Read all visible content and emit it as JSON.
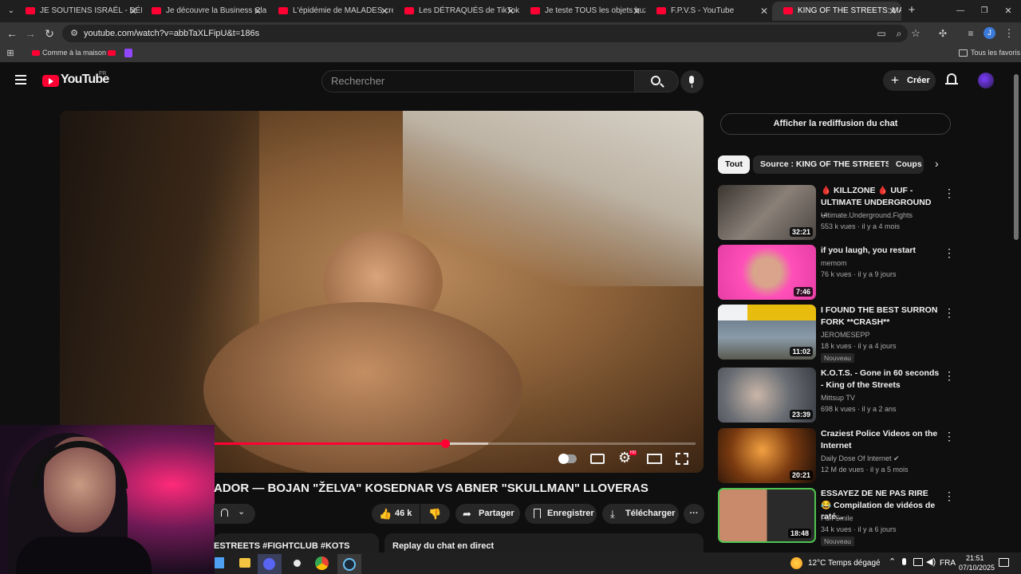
{
  "browser": {
    "tabs": [
      {
        "title": "JE SOUTIENS ISRAËL - DÉBAT DU"
      },
      {
        "title": "Je découvre la Business Class en"
      },
      {
        "title": "L'épidémie de MALADES créée"
      },
      {
        "title": "Les DÉTRAQUÉS de TikTok - Yo"
      },
      {
        "title": "Je teste TOUS les objets buzz d"
      },
      {
        "title": "F.P.V.S - YouTube"
      },
      {
        "title": "KING OF THE STREETS: MATADO"
      }
    ],
    "new_tab": "+",
    "url": "youtube.com/watch?v=abbTaXLFipU&t=186s",
    "bookmark_home": "Comme à la maison",
    "all_bookmarks": "Tous les favoris",
    "profile_letter": "J"
  },
  "youtube": {
    "logo": "YouTube",
    "region": "FR",
    "search_placeholder": "Rechercher",
    "create_label": "Créer",
    "video_title": "ADOR — BOJAN \"ŽELVA\" KOSEDNAR VS ABNER \"SKULLMAN\" LLOVERAS",
    "progress": 0.48,
    "buffered": 0.57,
    "hd_badge": "HD",
    "likes": "46 k",
    "share": "Partager",
    "save": "Enregistrer",
    "download": "Télécharger",
    "more": "···",
    "hashtags": "ESTREETS #FIGHTCLUB #KOTS",
    "replay_chat": "Replay du chat en direct",
    "show_chat": "Afficher la rediffusion du chat",
    "chips": [
      "Tout",
      "Source : KING OF THE STREETS",
      "Coups"
    ],
    "recommendations": [
      {
        "title": "🩸 KILLZONE 🩸 UUF - ULTIMATE UNDERGROUND ...",
        "channel": "Ultimate.Underground.Fights",
        "meta": "553 k vues · il y a 4 mois",
        "duration": "32:21",
        "badge": ""
      },
      {
        "title": "if you laugh, you restart",
        "channel": "memom",
        "meta": "76 k vues · il y a 9 jours",
        "duration": "7:46",
        "badge": ""
      },
      {
        "title": "I FOUND THE BEST SURRON FORK **CRASH**",
        "channel": "JEROMESEPP",
        "meta": "18 k vues · il y a 4 jours",
        "duration": "11:02",
        "badge": "Nouveau"
      },
      {
        "title": "K.O.T.S. - Gone in 60 seconds - King of the Streets",
        "channel": "Mittsup TV",
        "meta": "698 k vues · il y a 2 ans",
        "duration": "23:39",
        "badge": ""
      },
      {
        "title": "Craziest Police Videos on the Internet",
        "channel": "Daily Dose Of Internet ✔",
        "meta": "12 M de vues · il y a 5 mois",
        "duration": "20:21",
        "badge": ""
      },
      {
        "title": "ESSAYEZ DE NE PAS RIRE 😂 Compilation de vidéos de raté...",
        "channel": "Fun Smile",
        "meta": "34 k vues · il y a 6 jours",
        "duration": "18:48",
        "badge": "Nouveau"
      }
    ]
  },
  "taskbar": {
    "weather": "12°C",
    "weather_text": "Temps dégagé",
    "lang": "FRA",
    "time": "21:51",
    "date": "07/10/2025"
  },
  "colors": {
    "accent": "#ff0033",
    "bg": "#0f0f0f"
  }
}
